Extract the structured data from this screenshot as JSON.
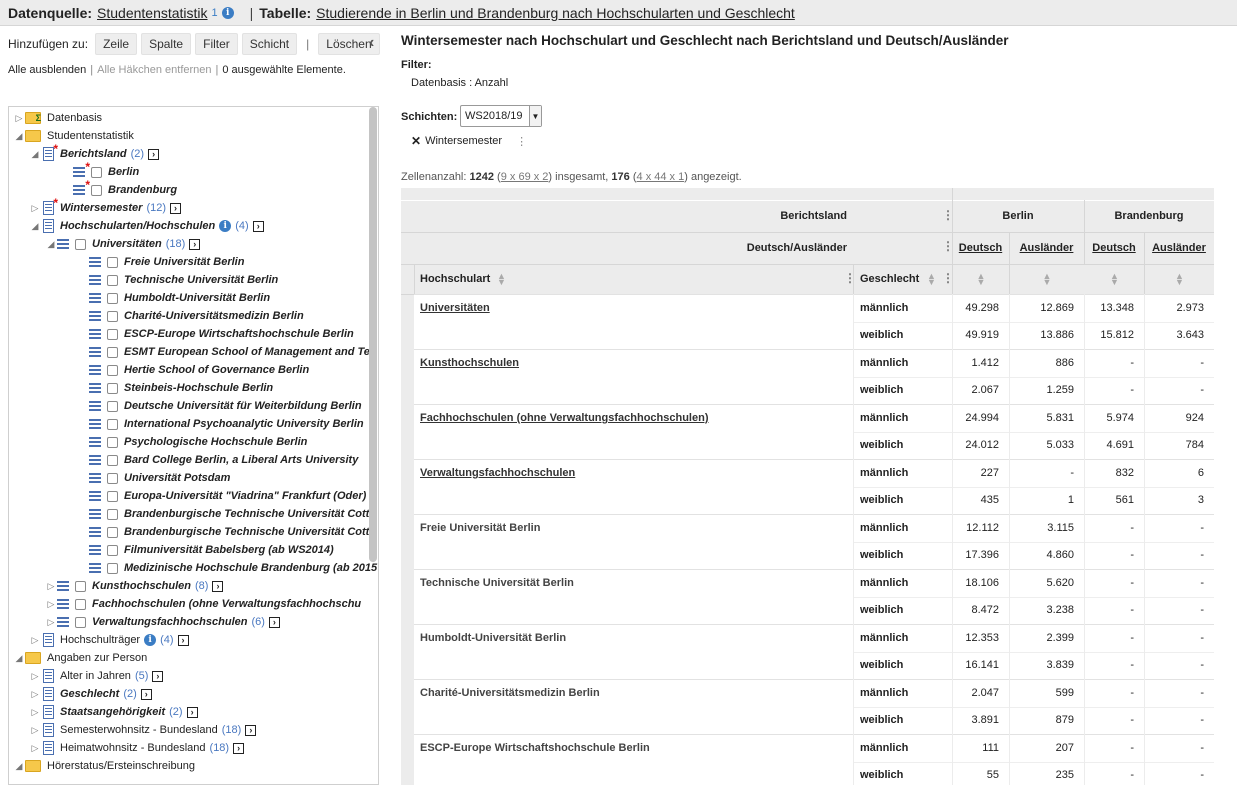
{
  "topbar": {
    "datasource_label": "Datenquelle:",
    "datasource_value": "Studentenstatistik",
    "datasource_count": "1",
    "table_label": "Tabelle:",
    "table_value": "Studierende in Berlin und Brandenburg nach Hochschularten und Geschlecht"
  },
  "toolbar": {
    "add_label": "Hinzufügen zu:",
    "row": "Zeile",
    "column": "Spalte",
    "filter": "Filter",
    "layer": "Schicht",
    "delete": "Löschen"
  },
  "links": {
    "hide_all": "Alle ausblenden",
    "remove_checks": "Alle Häkchen entfernen",
    "selected": "0 ausgewählte Elemente."
  },
  "tree": [
    {
      "label": "Datenbasis",
      "count": ""
    },
    {
      "label": "Studentenstatistik",
      "count": ""
    },
    {
      "label": "Berichtsland",
      "count": "(2)"
    },
    {
      "label": "Berlin",
      "count": ""
    },
    {
      "label": "Brandenburg",
      "count": ""
    },
    {
      "label": "Wintersemester",
      "count": "(12)"
    },
    {
      "label": "Hochschularten/Hochschulen",
      "count": "(4)"
    },
    {
      "label": "Universitäten",
      "count": "(18)"
    },
    {
      "label": "Freie Universität Berlin",
      "count": ""
    },
    {
      "label": "Technische Universität Berlin",
      "count": ""
    },
    {
      "label": "Humboldt-Universität Berlin",
      "count": ""
    },
    {
      "label": "Charité-Universitätsmedizin Berlin",
      "count": ""
    },
    {
      "label": "ESCP-Europe Wirtschaftshochschule Berlin",
      "count": ""
    },
    {
      "label": "ESMT European School of Management and Tec",
      "count": ""
    },
    {
      "label": "Hertie School of Governance Berlin",
      "count": ""
    },
    {
      "label": "Steinbeis-Hochschule Berlin",
      "count": ""
    },
    {
      "label": "Deutsche Universität für Weiterbildung Berlin",
      "count": ""
    },
    {
      "label": "International Psychoanalytic University Berlin",
      "count": ""
    },
    {
      "label": "Psychologische Hochschule Berlin",
      "count": ""
    },
    {
      "label": "Bard College Berlin, a Liberal Arts University",
      "count": ""
    },
    {
      "label": "Universität Potsdam",
      "count": ""
    },
    {
      "label": "Europa-Universität \"Viadrina\" Frankfurt (Oder)",
      "count": ""
    },
    {
      "label": "Brandenburgische Technische Universität Cottb",
      "count": ""
    },
    {
      "label": "Brandenburgische Technische Universität Cottb",
      "count": ""
    },
    {
      "label": "Filmuniversität Babelsberg (ab WS2014)",
      "count": ""
    },
    {
      "label": "Medizinische Hochschule Brandenburg (ab 2015",
      "count": ""
    },
    {
      "label": "Kunsthochschulen",
      "count": "(8)"
    },
    {
      "label": "Fachhochschulen (ohne Verwaltungsfachhochschu",
      "count": ""
    },
    {
      "label": "Verwaltungsfachhochschulen",
      "count": "(6)"
    },
    {
      "label": "Hochschulträger",
      "count": "(4)"
    },
    {
      "label": "Angaben zur Person",
      "count": ""
    },
    {
      "label": "Alter in Jahren",
      "count": "(5)"
    },
    {
      "label": "Geschlecht",
      "count": "(2)"
    },
    {
      "label": "Staatsangehörigkeit",
      "count": "(2)"
    },
    {
      "label": "Semesterwohnsitz - Bundesland",
      "count": "(18)"
    },
    {
      "label": "Heimatwohnsitz - Bundesland",
      "count": "(18)"
    },
    {
      "label": "Hörerstatus/Ersteinschreibung",
      "count": ""
    }
  ],
  "main": {
    "title": "Wintersemester nach Hochschulart und Geschlecht nach Berichtsland und Deutsch/Ausländer",
    "filter_label": "Filter:",
    "filter_value": "Datenbasis  : Anzahl",
    "schichten_label": "Schichten:",
    "schichten_value": "WS2018/19",
    "chip_label": "Wintersemester",
    "cells": {
      "prefix": "Zellenanzahl:",
      "total": "1242",
      "total_dims": "9 x 69 x 2",
      "mid": "insgesamt,",
      "shown": "176",
      "shown_dims": "4 x 44 x 1",
      "suffix": "angezeigt."
    }
  },
  "table": {
    "berichtsland_header": "Berichtsland",
    "countries": [
      "Berlin",
      "Brandenburg"
    ],
    "da_header": "Deutsch/Ausländer",
    "da_columns": [
      "Deutsch",
      "Ausländer",
      "Deutsch",
      "Ausländer"
    ],
    "row_header": "Hochschulart",
    "gender_header": "Geschlecht",
    "rows": [
      {
        "label": "Universitäten",
        "link": true,
        "m": [
          "49.298",
          "12.869",
          "13.348",
          "2.973"
        ],
        "w": [
          "49.919",
          "13.886",
          "15.812",
          "3.643"
        ]
      },
      {
        "label": "Kunsthochschulen",
        "link": true,
        "m": [
          "1.412",
          "886",
          "-",
          "-"
        ],
        "w": [
          "2.067",
          "1.259",
          "-",
          "-"
        ]
      },
      {
        "label": "Fachhochschulen (ohne Verwaltungsfachhochschulen)",
        "link": true,
        "m": [
          "24.994",
          "5.831",
          "5.974",
          "924"
        ],
        "w": [
          "24.012",
          "5.033",
          "4.691",
          "784"
        ]
      },
      {
        "label": "Verwaltungsfachhochschulen",
        "link": true,
        "m": [
          "227",
          "-",
          "832",
          "6"
        ],
        "w": [
          "435",
          "1",
          "561",
          "3"
        ]
      },
      {
        "label": "Freie Universität Berlin",
        "link": false,
        "m": [
          "12.112",
          "3.115",
          "-",
          "-"
        ],
        "w": [
          "17.396",
          "4.860",
          "-",
          "-"
        ]
      },
      {
        "label": "Technische Universität Berlin",
        "link": false,
        "m": [
          "18.106",
          "5.620",
          "-",
          "-"
        ],
        "w": [
          "8.472",
          "3.238",
          "-",
          "-"
        ]
      },
      {
        "label": "Humboldt-Universität Berlin",
        "link": false,
        "m": [
          "12.353",
          "2.399",
          "-",
          "-"
        ],
        "w": [
          "16.141",
          "3.839",
          "-",
          "-"
        ]
      },
      {
        "label": "Charité-Universitätsmedizin Berlin",
        "link": false,
        "m": [
          "2.047",
          "599",
          "-",
          "-"
        ],
        "w": [
          "3.891",
          "879",
          "-",
          "-"
        ]
      },
      {
        "label": "ESCP-Europe Wirtschaftshochschule Berlin",
        "link": false,
        "m": [
          "111",
          "207",
          "-",
          "-"
        ],
        "w": [
          "55",
          "235",
          "-",
          "-"
        ]
      }
    ],
    "male": "männlich",
    "female": "weiblich"
  }
}
